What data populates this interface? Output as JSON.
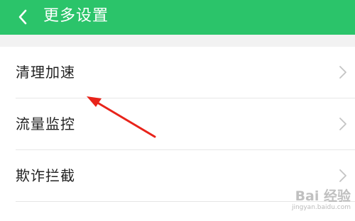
{
  "header": {
    "title": "更多设置",
    "back_icon": "chevron-left-icon",
    "background_color": "#2bc46a"
  },
  "list": {
    "items": [
      {
        "label": "清理加速",
        "icon": "chevron-right-icon"
      },
      {
        "label": "流量监控",
        "icon": "chevron-right-icon"
      },
      {
        "label": "欺诈拦截",
        "icon": "chevron-right-icon"
      }
    ]
  },
  "annotation": {
    "arrow_color": "#e8231a"
  },
  "watermark": {
    "main": "Bai  经验",
    "sub": "jingyan.baidu.com"
  }
}
